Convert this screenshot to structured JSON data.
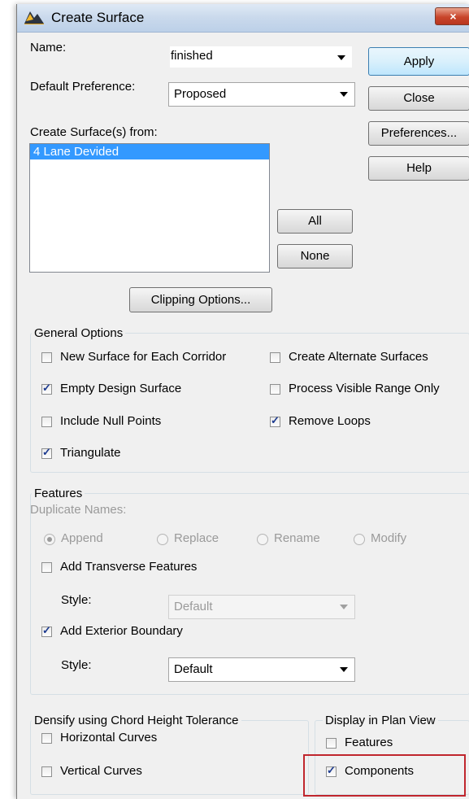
{
  "window": {
    "title": "Create Surface",
    "close_symbol": "×"
  },
  "form": {
    "name_label": "Name:",
    "name_value": "finished",
    "pref_label": "Default Preference:",
    "pref_value": "Proposed",
    "create_from_label": "Create Surface(s) from:",
    "list_items": [
      "4 Lane Devided"
    ]
  },
  "buttons": {
    "apply": "Apply",
    "close": "Close",
    "preferences": "Preferences...",
    "help": "Help",
    "all": "All",
    "none": "None",
    "clipping": "Clipping Options..."
  },
  "general_options": {
    "title": "General Options",
    "new_surface_each_corridor": {
      "label": "New Surface for Each Corridor",
      "checked": false
    },
    "create_alternate_surfaces": {
      "label": "Create Alternate Surfaces",
      "checked": false
    },
    "empty_design_surface": {
      "label": "Empty Design Surface",
      "checked": true
    },
    "process_visible_range_only": {
      "label": "Process Visible Range Only",
      "checked": false
    },
    "include_null_points": {
      "label": "Include Null Points",
      "checked": false
    },
    "remove_loops": {
      "label": "Remove Loops",
      "checked": true
    },
    "triangulate": {
      "label": "Triangulate",
      "checked": true
    }
  },
  "features": {
    "title": "Features",
    "duplicate_names_label": "Duplicate Names:",
    "radios": [
      {
        "label": "Append",
        "selected": true
      },
      {
        "label": "Replace",
        "selected": false
      },
      {
        "label": "Rename",
        "selected": false
      },
      {
        "label": "Modify",
        "selected": false
      }
    ],
    "add_transverse": {
      "label": "Add Transverse Features",
      "checked": false
    },
    "style_label_1": "Style:",
    "style_value_1": "Default",
    "add_exterior_boundary": {
      "label": "Add Exterior Boundary",
      "checked": true
    },
    "style_label_2": "Style:",
    "style_value_2": "Default"
  },
  "densify": {
    "title": "Densify using Chord Height Tolerance",
    "horizontal_curves": {
      "label": "Horizontal Curves",
      "checked": false
    },
    "vertical_curves": {
      "label": "Vertical Curves",
      "checked": false
    }
  },
  "display": {
    "title": "Display in Plan View",
    "features": {
      "label": "Features",
      "checked": false
    },
    "components": {
      "label": "Components",
      "checked": true
    }
  },
  "colors": {
    "highlight": "#c0262d",
    "selection": "#3399ff"
  }
}
